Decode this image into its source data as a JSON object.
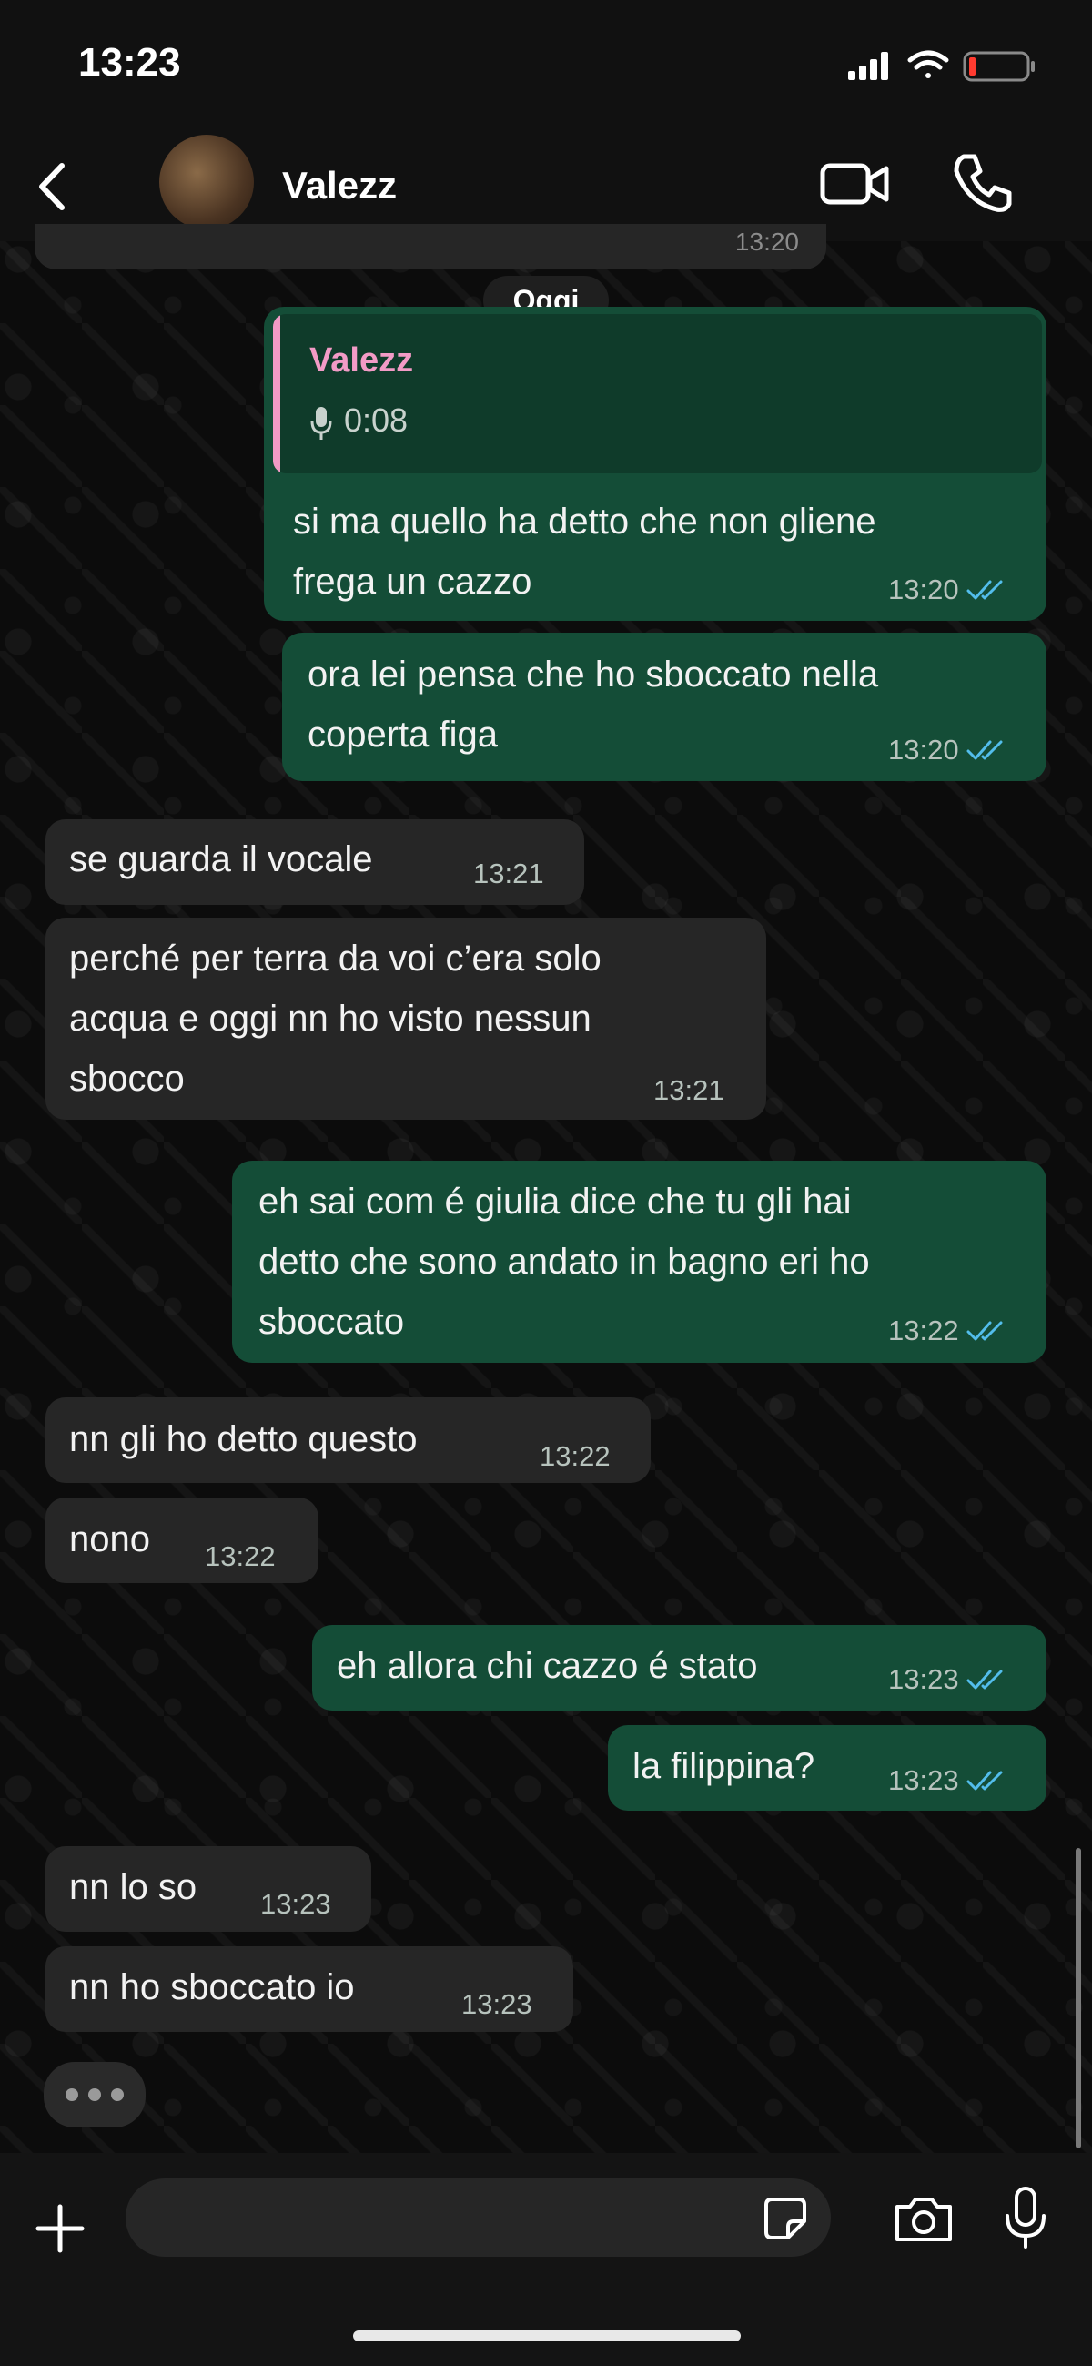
{
  "status_bar": {
    "time": "13:23"
  },
  "header": {
    "contact_name": "Valezz"
  },
  "chat": {
    "previous_time": "13:20",
    "day_separator": "Oggi",
    "messages": [
      {
        "dir": "out",
        "quote": {
          "author": "Valezz",
          "duration": "0:08"
        },
        "lines": [
          "si ma quello ha detto che non gliene",
          "frega un cazzo"
        ],
        "time": "13:20"
      },
      {
        "dir": "out",
        "lines": [
          "ora lei pensa che ho sboccato nella",
          "coperta figa"
        ],
        "time": "13:20"
      },
      {
        "dir": "in",
        "lines": [
          "se guarda il vocale"
        ],
        "time": "13:21"
      },
      {
        "dir": "in",
        "lines": [
          "perché per terra da voi c’era solo",
          "acqua e oggi nn ho visto nessun",
          "sbocco"
        ],
        "time": "13:21"
      },
      {
        "dir": "out",
        "lines": [
          "eh sai com é giulia dice che tu gli hai",
          "detto che sono andato in bagno eri ho",
          "sboccato"
        ],
        "time": "13:22"
      },
      {
        "dir": "in",
        "lines": [
          "nn gli ho detto questo"
        ],
        "time": "13:22"
      },
      {
        "dir": "in",
        "lines": [
          "nono"
        ],
        "time": "13:22"
      },
      {
        "dir": "out",
        "lines": [
          "eh allora chi cazzo é stato"
        ],
        "time": "13:23"
      },
      {
        "dir": "out",
        "lines": [
          "la filippina?"
        ],
        "time": "13:23"
      },
      {
        "dir": "in",
        "lines": [
          "nn lo so"
        ],
        "time": "13:23"
      },
      {
        "dir": "in",
        "lines": [
          "nn ho sboccato io"
        ],
        "time": "13:23"
      }
    ]
  },
  "composer": {
    "placeholder": ""
  },
  "colors": {
    "outgoing_bubble": "#144d37",
    "incoming_bubble": "#262626",
    "read_ticks": "#53bdeb",
    "quote_accent": "#f29bc6"
  },
  "icons": [
    "back-icon",
    "video-call-icon",
    "phone-icon",
    "mic-icon",
    "read-ticks-icon",
    "plus-icon",
    "sticker-icon",
    "camera-icon"
  ]
}
